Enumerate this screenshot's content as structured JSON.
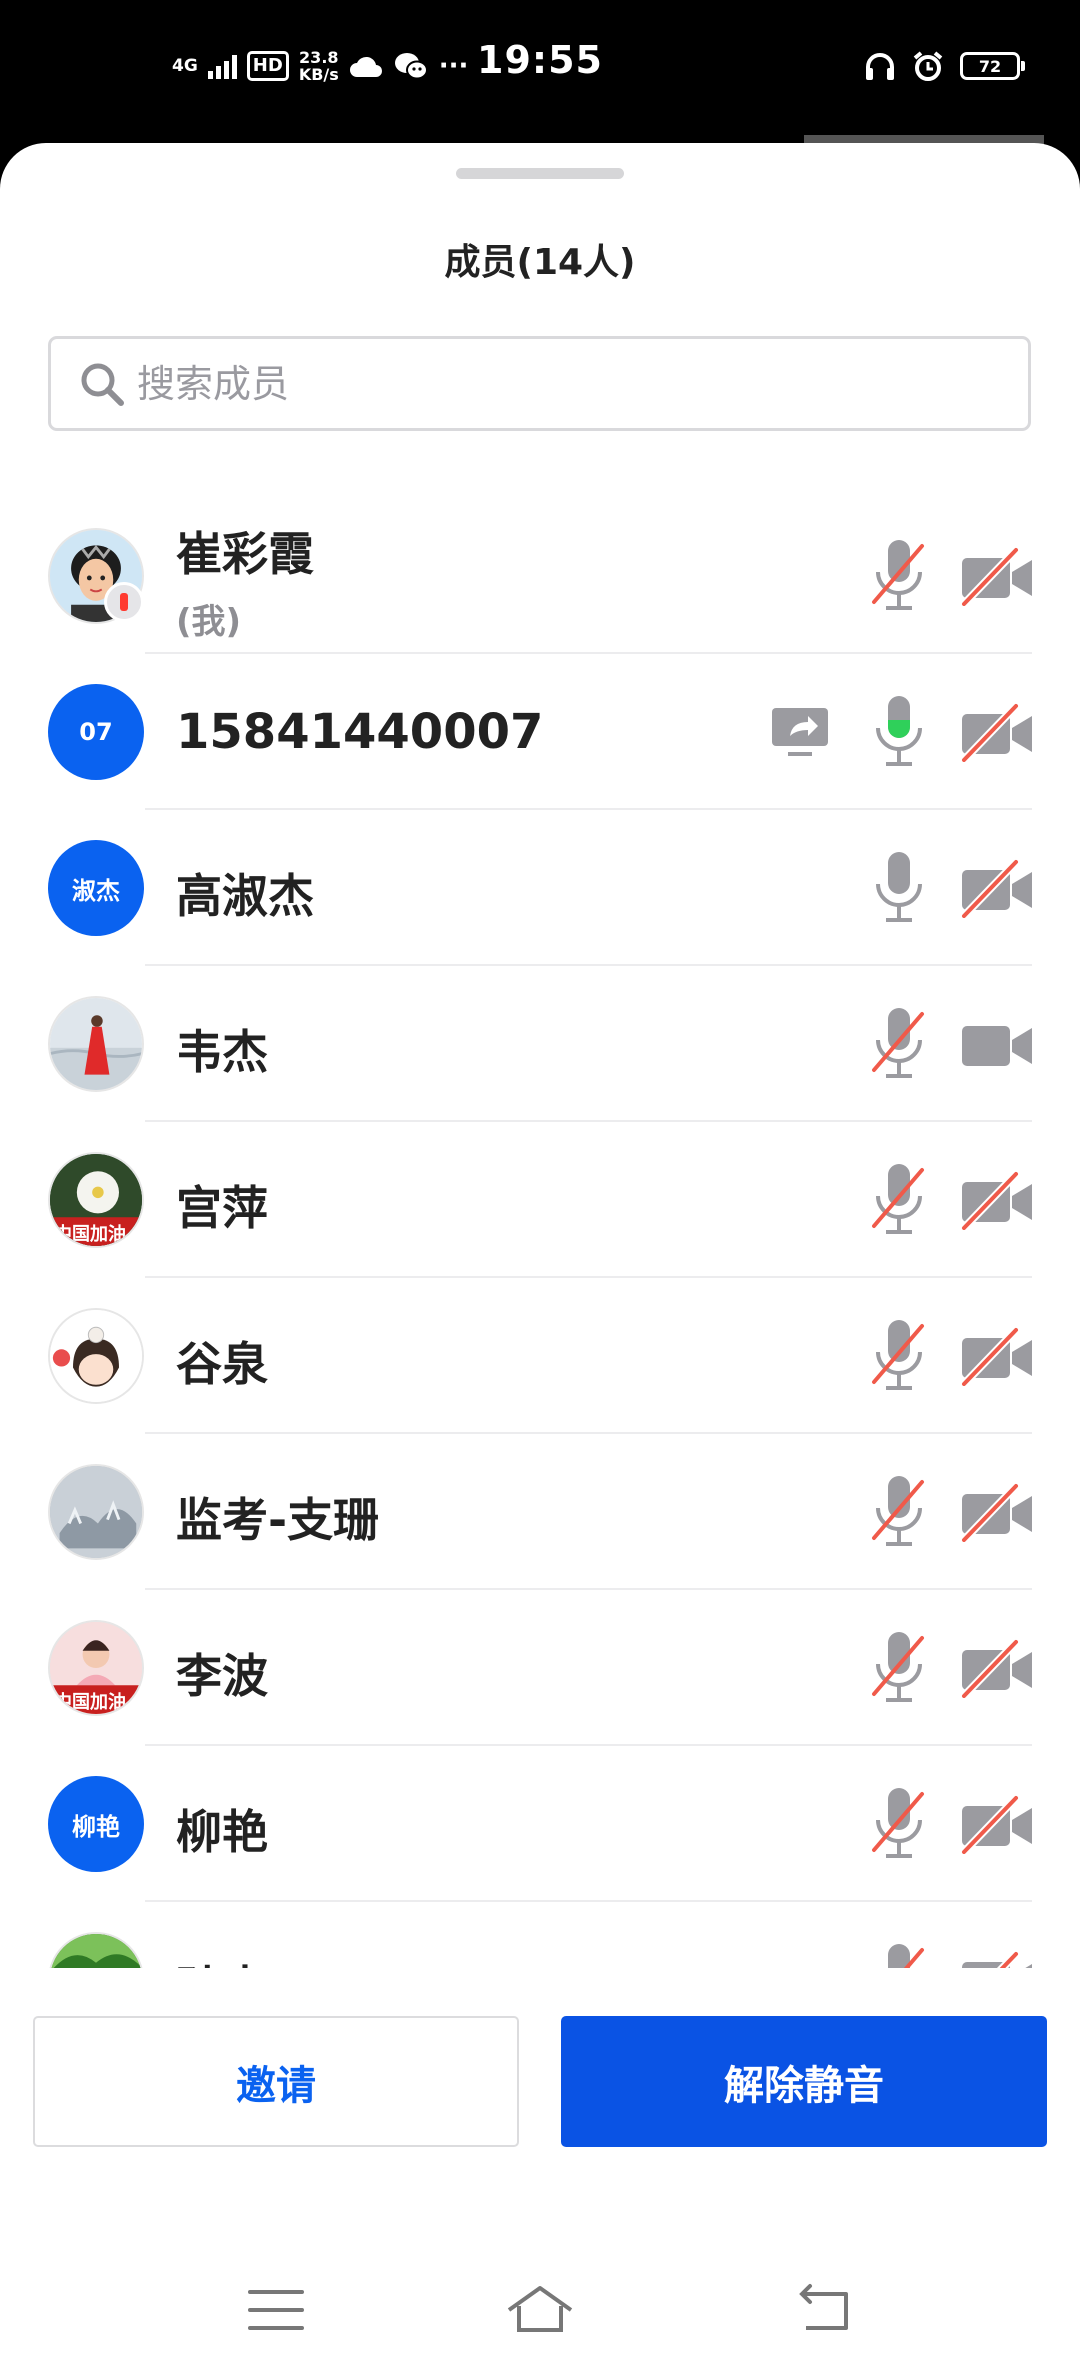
{
  "status_bar": {
    "network": "4G",
    "hd": "HD",
    "speed_value": "23.8",
    "speed_unit": "KB/s",
    "more": "···",
    "time": "19:55",
    "battery": "72"
  },
  "sheet": {
    "title": "成员(14人)",
    "search_placeholder": "搜索成员"
  },
  "members": [
    {
      "name": "崔彩霞",
      "sub": "(我)",
      "avatar_text": "",
      "mic": "muted",
      "camera": "off"
    },
    {
      "name": "15841440007",
      "sub": "",
      "avatar_text": "07",
      "mic": "active",
      "camera": "off",
      "sharing": true
    },
    {
      "name": "高淑杰",
      "sub": "",
      "avatar_text": "淑杰",
      "mic": "unmuted",
      "camera": "off"
    },
    {
      "name": "韦杰",
      "sub": "",
      "avatar_text": "",
      "mic": "muted",
      "camera": "on"
    },
    {
      "name": "宫萍",
      "sub": "",
      "avatar_text": "中国加油",
      "mic": "muted",
      "camera": "off"
    },
    {
      "name": "谷泉",
      "sub": "",
      "avatar_text": "",
      "mic": "muted",
      "camera": "off"
    },
    {
      "name": "监考-支珊",
      "sub": "",
      "avatar_text": "",
      "mic": "muted",
      "camera": "off"
    },
    {
      "name": "李波",
      "sub": "",
      "avatar_text": "中国加油",
      "mic": "muted",
      "camera": "off"
    },
    {
      "name": "柳艳",
      "sub": "",
      "avatar_text": "柳艳",
      "mic": "muted",
      "camera": "off"
    },
    {
      "name": "孙丰",
      "sub": "",
      "avatar_text": "",
      "mic": "muted",
      "camera": "off"
    }
  ],
  "buttons": {
    "invite": "邀请",
    "unmute": "解除静音"
  },
  "colors": {
    "accent": "#0a62f0",
    "primary_button": "#0a53e4",
    "muted_slash": "#f05a4a",
    "icon_gray": "#9b9ba0",
    "mic_active": "#2fd05a"
  },
  "nav": [
    "menu-icon",
    "home-icon",
    "back-icon"
  ]
}
